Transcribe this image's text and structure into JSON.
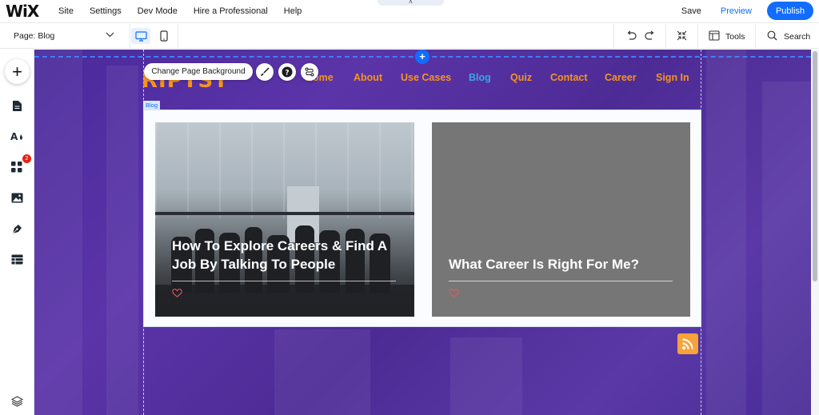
{
  "app": {
    "logo": "WiX",
    "menu": [
      "Site",
      "Settings",
      "Dev Mode",
      "Hire a Professional",
      "Help"
    ],
    "save_label": "Save",
    "preview_label": "Preview",
    "publish_label": "Publish",
    "notch_icon": "chevron-up-icon"
  },
  "toolbar": {
    "page_label": "Page: Blog",
    "tools_label": "Tools",
    "search_label": "Search"
  },
  "sidebar": {
    "items": [
      {
        "name": "add-elements",
        "icon": "plus-icon"
      },
      {
        "name": "pages",
        "icon": "page-icon"
      },
      {
        "name": "design",
        "icon": "theme-icon"
      },
      {
        "name": "apps",
        "icon": "apps-grid-icon",
        "badge": "2"
      },
      {
        "name": "media",
        "icon": "image-icon"
      },
      {
        "name": "blog",
        "icon": "pen-nib-icon"
      },
      {
        "name": "cms",
        "icon": "table-icon"
      },
      {
        "name": "layers",
        "icon": "layers-icon"
      }
    ]
  },
  "canvas": {
    "site_logo": "RIPTST",
    "change_bg_label": "Change Page Background",
    "blog_tag": "Blog",
    "nav": [
      {
        "label": "Home",
        "active": false
      },
      {
        "label": "About",
        "active": false
      },
      {
        "label": "Use Cases",
        "active": false
      },
      {
        "label": "Blog",
        "active": true
      },
      {
        "label": "Quiz",
        "active": false
      },
      {
        "label": "Contact",
        "active": false
      },
      {
        "label": "Career",
        "active": false
      },
      {
        "label": "Sign In",
        "active": false
      }
    ],
    "posts": [
      {
        "title": "How To Explore Careers & Find A Job By Talking To People"
      },
      {
        "title": "What Career Is Right For Me?"
      }
    ]
  },
  "colors": {
    "accent": "#116dff",
    "nav_orange": "#f7941d",
    "nav_active": "#3aa6e6",
    "canvas_purple": "#4d2b95"
  }
}
